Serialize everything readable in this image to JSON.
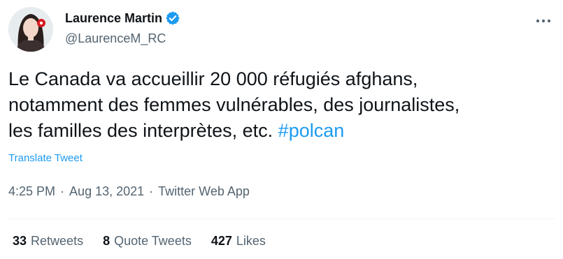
{
  "author": {
    "display_name": "Laurence Martin",
    "handle": "@LaurenceM_RC",
    "verified_icon": "verified-badge-icon"
  },
  "tweet": {
    "text_main": "Le Canada va accueillir 20 000 réfugiés afghans,\nnotamment des femmes vulnérables, des journalistes,\nles familles des interprètes, etc. ",
    "hashtag": "#polcan",
    "translate_label": "Translate Tweet"
  },
  "meta": {
    "time": "4:25 PM",
    "sep1": "·",
    "date": "Aug 13, 2021",
    "sep2": "·",
    "source": "Twitter Web App"
  },
  "stats": {
    "retweets_count": "33",
    "retweets_label": "Retweets",
    "quotes_count": "8",
    "quotes_label": "Quote Tweets",
    "likes_count": "427",
    "likes_label": "Likes"
  },
  "colors": {
    "link": "#1d9bf0",
    "secondary_text": "#536471",
    "primary_text": "#0f1419",
    "verified": "#1d9bf0",
    "avatar_brand_red": "#d71920"
  }
}
